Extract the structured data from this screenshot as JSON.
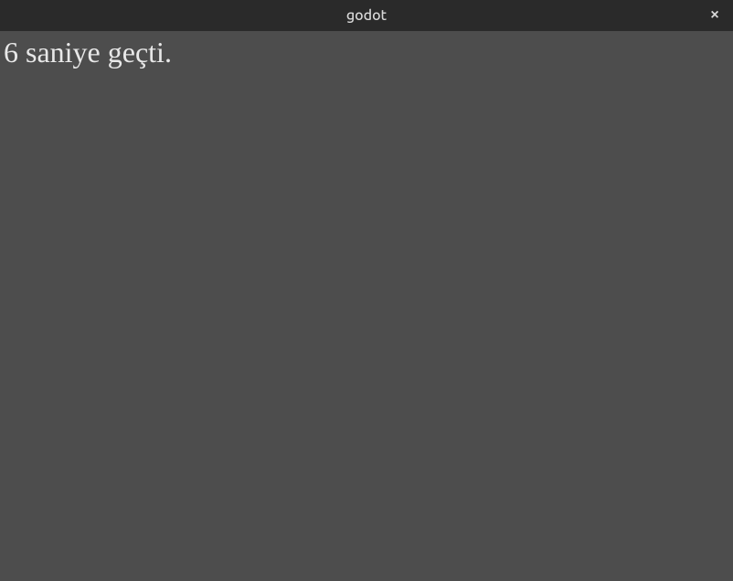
{
  "window": {
    "title": "godot"
  },
  "content": {
    "status_text": "6 saniye geçti."
  }
}
